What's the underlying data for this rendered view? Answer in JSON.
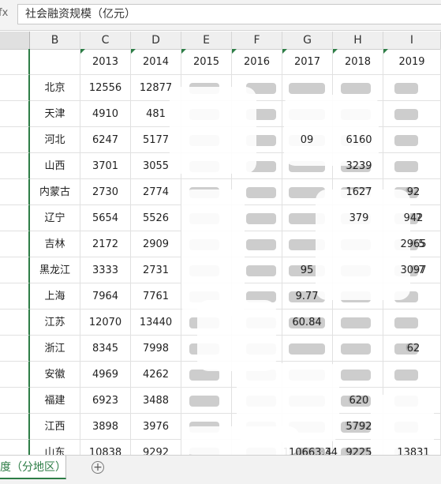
{
  "formula_bar": {
    "fx_label": "fx",
    "content": "社会融资规模（亿元）"
  },
  "columns": [
    "B",
    "C",
    "D",
    "E",
    "F",
    "G",
    "H",
    "I"
  ],
  "years": [
    "2013",
    "2014",
    "2015",
    "2016",
    "2017",
    "2018",
    "2019"
  ],
  "rows": [
    {
      "region": "北京",
      "c": "12556",
      "d": "12877",
      "g": "",
      "h": "",
      "i": ""
    },
    {
      "region": "天津",
      "c": "4910",
      "d": "481",
      "g": "",
      "h": "",
      "i": ""
    },
    {
      "region": "河北",
      "c": "6247",
      "d": "5177",
      "g": "09",
      "h": "6160",
      "i": ""
    },
    {
      "region": "山西",
      "c": "3701",
      "d": "3055",
      "g": "",
      "h": "3239",
      "i": ""
    },
    {
      "region": "内蒙古",
      "c": "2730",
      "d": "2774",
      "g": "",
      "h": "1627",
      "i": "92"
    },
    {
      "region": "辽宁",
      "c": "5654",
      "d": "5526",
      "g": "",
      "h": "379",
      "i": "942"
    },
    {
      "region": "吉林",
      "c": "2172",
      "d": "2909",
      "g": "",
      "h": "",
      "i": "2965"
    },
    {
      "region": "黑龙江",
      "c": "3333",
      "d": "2731",
      "g": "95",
      "h": "",
      "i": "3097"
    },
    {
      "region": "上海",
      "c": "7964",
      "d": "7761",
      "g": "9.77",
      "h": "",
      "i": ""
    },
    {
      "region": "江苏",
      "c": "12070",
      "d": "13440",
      "g": "60.84",
      "h": "",
      "i": ""
    },
    {
      "region": "浙江",
      "c": "8345",
      "d": "7998",
      "g": "",
      "h": "",
      "i": "62"
    },
    {
      "region": "安徽",
      "c": "4969",
      "d": "4262",
      "g": "",
      "h": "",
      "i": ""
    },
    {
      "region": "福建",
      "c": "6923",
      "d": "3488",
      "g": "",
      "h": "620",
      "i": ""
    },
    {
      "region": "江西",
      "c": "3898",
      "d": "3976",
      "g": "",
      "h": "5792",
      "i": ""
    },
    {
      "region": "山东",
      "c": "10838",
      "d": "9292",
      "g": "10663.34",
      "h": "9225",
      "i": "13831"
    }
  ],
  "sheet_tab": {
    "label": "度（分地区）"
  },
  "add_sheet_label": "+"
}
